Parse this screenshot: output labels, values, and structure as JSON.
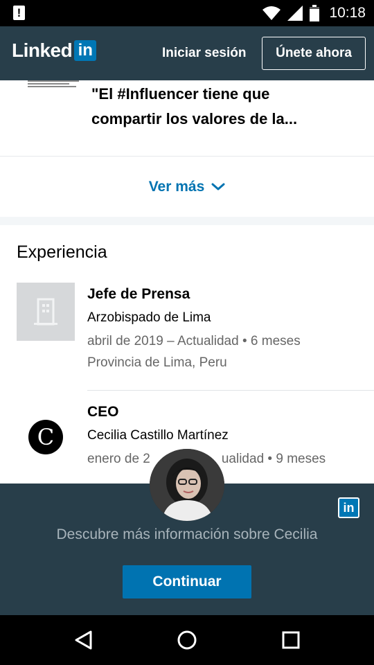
{
  "status_bar": {
    "time": "10:18",
    "icons": [
      "alert-icon",
      "wifi-icon",
      "signal-icon",
      "battery-icon"
    ]
  },
  "header": {
    "logo_text": "Linked",
    "logo_badge": "in",
    "signin_label": "Iniciar sesión",
    "join_label": "Únete ahora",
    "bg_color": "#283e4a",
    "brand_color": "#0077b5"
  },
  "post": {
    "text": "\"El #Influencer tiene que compartir los valores de la..."
  },
  "see_more": {
    "label": "Ver más",
    "icon": "chevron-down-icon"
  },
  "experience": {
    "title": "Experiencia",
    "items": [
      {
        "title": "Jefe de Prensa",
        "company": "Arzobispado de Lima",
        "dates": "abril de 2019 – Actualidad",
        "duration": "6 meses",
        "location": "Provincia de Lima, Peru",
        "logo_icon": "building-icon"
      },
      {
        "title": "CEO",
        "company": "Cecilia Castillo Martínez",
        "dates_visible_start": "enero de 2",
        "dates_visible_end": "ualidad",
        "duration": "9 meses",
        "logo_letter": "C"
      }
    ]
  },
  "cta": {
    "badge": "in",
    "text": "Descubre más información sobre Cecilia",
    "button_label": "Continuar",
    "button_color": "#0073b1"
  },
  "nav": {
    "icons": [
      "back-icon",
      "home-icon",
      "recents-icon"
    ]
  }
}
